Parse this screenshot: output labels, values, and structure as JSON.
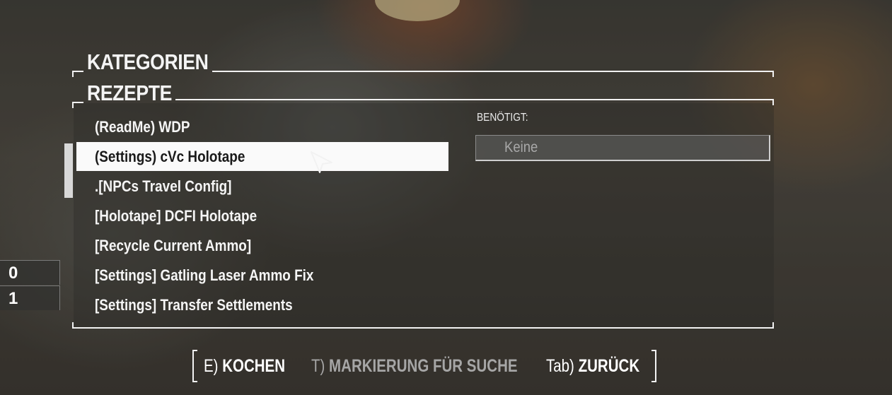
{
  "categories_header": "KATEGORIEN",
  "recipes_header": "REZEPTE",
  "recipes": [
    {
      "label": "(ReadMe) WDP",
      "selected": false
    },
    {
      "label": "(Settings) cVc Holotape",
      "selected": true
    },
    {
      "label": ".[NPCs Travel Config]",
      "selected": false
    },
    {
      "label": "[Holotape] DCFI Holotape",
      "selected": false
    },
    {
      "label": "[Recycle Current Ammo]",
      "selected": false
    },
    {
      "label": "[Settings] Gatling Laser Ammo Fix",
      "selected": false
    },
    {
      "label": "[Settings] Transfer Settlements",
      "selected": false
    }
  ],
  "requires": {
    "label": "BENÖTIGT:",
    "value": "Keine"
  },
  "counters": [
    "0",
    "1"
  ],
  "footer": {
    "cook_key": "E)",
    "cook_action": "KOCHEN",
    "mark_key": "T)",
    "mark_action": "MARKIERUNG FÜR SUCHE",
    "back_key": "Tab)",
    "back_action": "ZURÜCK"
  },
  "colors": {
    "ui_text": "#f5f5f5",
    "selected_bg": "#fafafa",
    "disabled_text": "#a6a6a6"
  }
}
